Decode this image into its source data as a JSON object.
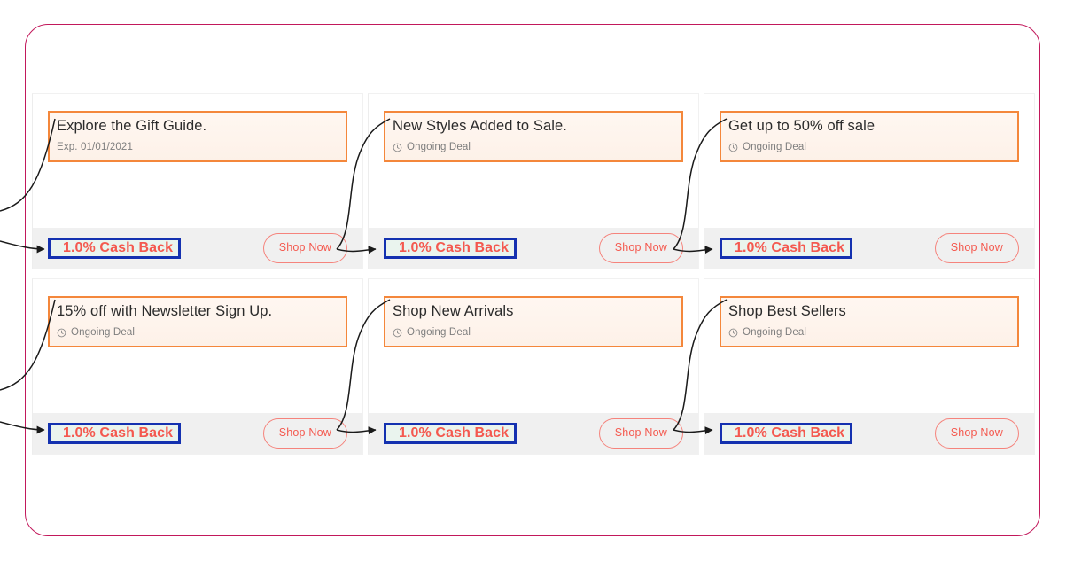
{
  "frame": {
    "border_color": "#c2185b"
  },
  "colors": {
    "title_box_border": "#f4873b",
    "title_box_bg": "#fff7f1",
    "cashback_box_border": "#1431b0",
    "cashback_box_bg": "#eaf4ee",
    "cashback_text": "#f4594f",
    "shop_now_border": "#f5837c",
    "footer_bg": "#f0f0f0",
    "annotation_arrow": "#2b2b2b"
  },
  "deals": [
    {
      "title": "Explore the Gift Guide.",
      "meta": "Exp. 01/01/2021",
      "meta_icon": "",
      "cashback": "1.0% Cash Back",
      "cta": "Shop Now"
    },
    {
      "title": "New Styles Added to Sale.",
      "meta": "Ongoing Deal",
      "meta_icon": "clock-icon",
      "cashback": "1.0% Cash Back",
      "cta": "Shop Now"
    },
    {
      "title": "Get up to 50% off sale",
      "meta": "Ongoing Deal",
      "meta_icon": "clock-icon",
      "cashback": "1.0% Cash Back",
      "cta": "Shop Now"
    },
    {
      "title": "15% off with Newsletter Sign Up.",
      "meta": "Ongoing Deal",
      "meta_icon": "clock-icon",
      "cashback": "1.0% Cash Back",
      "cta": "Shop Now"
    },
    {
      "title": "Shop New Arrivals",
      "meta": "Ongoing Deal",
      "meta_icon": "clock-icon",
      "cashback": "1.0% Cash Back",
      "cta": "Shop Now"
    },
    {
      "title": "Shop Best Sellers",
      "meta": "Ongoing Deal",
      "meta_icon": "clock-icon",
      "cashback": "1.0% Cash Back",
      "cta": "Shop Now"
    }
  ]
}
